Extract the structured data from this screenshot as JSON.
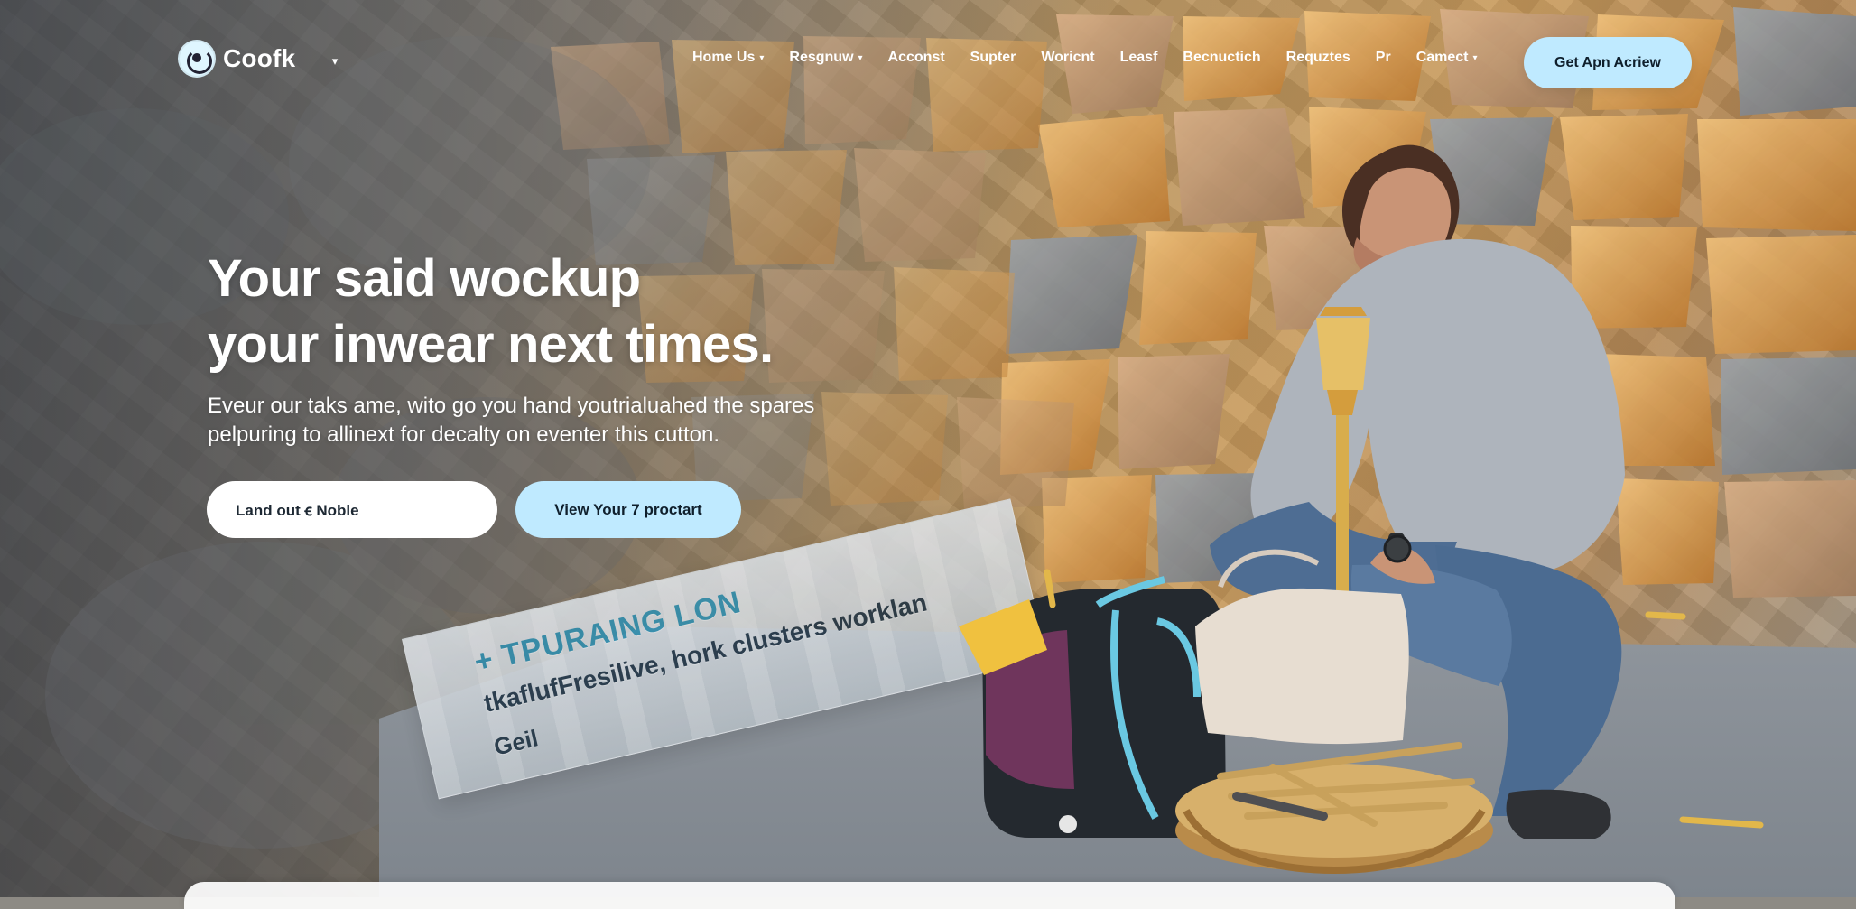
{
  "brand": {
    "name": "Coofk",
    "icon": "logo-icon"
  },
  "nav": {
    "links": [
      {
        "label": "Home Us",
        "has_dropdown": true
      },
      {
        "label": "Resgnuw",
        "has_dropdown": true
      },
      {
        "label": "Acconst",
        "has_dropdown": false
      },
      {
        "label": "Supter",
        "has_dropdown": false
      },
      {
        "label": "Woricnt",
        "has_dropdown": false
      },
      {
        "label": "Leasf",
        "has_dropdown": false
      },
      {
        "label": "Becnuctich",
        "has_dropdown": false
      },
      {
        "label": "Requztes",
        "has_dropdown": false
      },
      {
        "label": "Pr",
        "has_dropdown": false
      },
      {
        "label": "Camect",
        "has_dropdown": true
      }
    ],
    "cta_label": "Get Apn Acriew"
  },
  "hero": {
    "headline_lines": [
      "Your said wockup",
      "your inwear next times."
    ],
    "subtext_lines": [
      "Eveur our taks ame, wito go you hand youtrialuahed the spares",
      "pelpuring to allinext for decalty on eventer this cutton."
    ],
    "buttons": {
      "secondary": "Land out ꞓ Noble",
      "primary": "View Your 7 proctart"
    }
  },
  "scene": {
    "sign_lines": [
      "+ TPURAING LON",
      "tkaflufFresilive, hork clusters worklan",
      "Geil"
    ]
  },
  "colors": {
    "accent": "#bfeaff",
    "button_white": "#ffffff",
    "text_light": "#ffffff",
    "text_dark": "#0f1f2c"
  }
}
